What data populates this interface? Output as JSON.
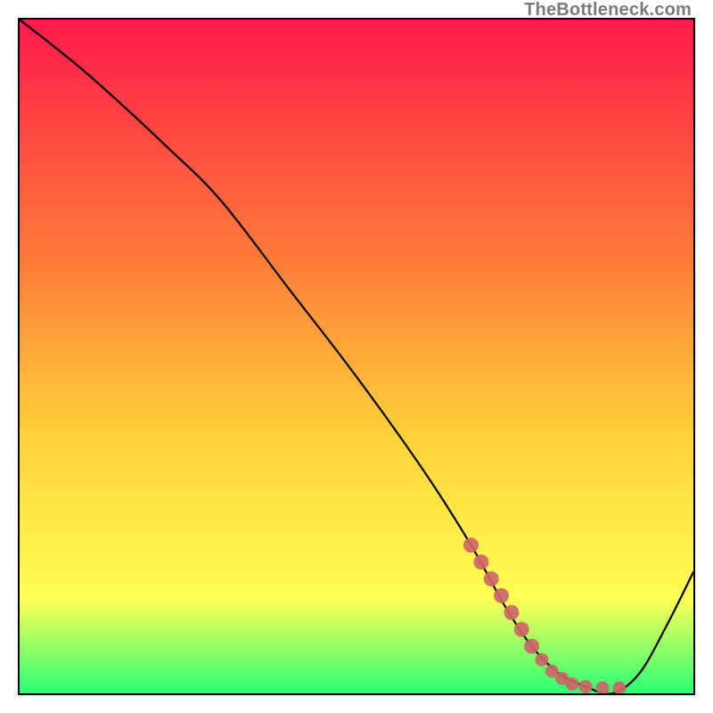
{
  "watermark": "TheBottleneck.com",
  "colors": {
    "gradient_top": "#ff1a4b",
    "gradient_mid1": "#ff7a3a",
    "gradient_mid2": "#ffd23a",
    "gradient_yellow": "#ffff55",
    "gradient_green": "#2aff75",
    "line": "#000000",
    "dots": "#cc6666"
  },
  "chart_data": {
    "type": "line",
    "title": "",
    "xlabel": "",
    "ylabel": "",
    "xlim": [
      0,
      100
    ],
    "ylim": [
      0,
      100
    ],
    "series": [
      {
        "name": "curve",
        "x": [
          0,
          10,
          22,
          30,
          40,
          50,
          60,
          67,
          72,
          76,
          80,
          84,
          88,
          92,
          96,
          100
        ],
        "y": [
          100,
          92,
          81,
          73,
          60,
          47,
          33,
          22,
          13,
          7,
          3,
          1,
          0,
          3,
          10,
          18
        ]
      }
    ],
    "dots": {
      "name": "highlight",
      "points": [
        {
          "x": 67,
          "y": 22
        },
        {
          "x": 68.5,
          "y": 19.5
        },
        {
          "x": 70,
          "y": 17
        },
        {
          "x": 71.5,
          "y": 14.5
        },
        {
          "x": 73,
          "y": 12
        },
        {
          "x": 74.5,
          "y": 9.5
        },
        {
          "x": 76,
          "y": 7
        },
        {
          "x": 77.5,
          "y": 5
        },
        {
          "x": 79,
          "y": 3.3
        },
        {
          "x": 80.5,
          "y": 2.2
        },
        {
          "x": 82,
          "y": 1.4
        },
        {
          "x": 84,
          "y": 1.0
        },
        {
          "x": 86.5,
          "y": 0.8
        },
        {
          "x": 89,
          "y": 0.8
        }
      ]
    }
  }
}
